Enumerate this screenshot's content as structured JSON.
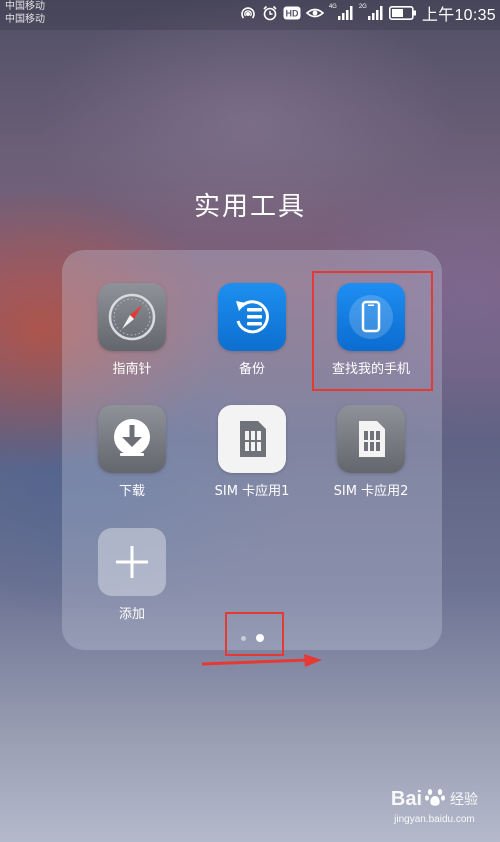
{
  "status_bar": {
    "carrier_1": "中国移动",
    "carrier_2": "中国移动",
    "hd_badge": "HD",
    "network_1": "4G",
    "network_2": "2G",
    "time": "上午10:35",
    "icons": [
      "hotspot-icon",
      "alarm-icon",
      "hd-call-icon",
      "eye-comfort-icon",
      "signal-icon",
      "battery-icon"
    ]
  },
  "folder": {
    "title": "实用工具",
    "apps": [
      {
        "label": "指南针",
        "icon": "compass-icon"
      },
      {
        "label": "备份",
        "icon": "backup-icon"
      },
      {
        "label": "查找我的手机",
        "icon": "find-my-phone-icon"
      },
      {
        "label": "下载",
        "icon": "download-icon"
      },
      {
        "label": "SIM 卡应用1",
        "icon": "sim-card-icon"
      },
      {
        "label": "SIM 卡应用2",
        "icon": "sim-card-icon"
      },
      {
        "label": "添加",
        "icon": "plus-icon"
      }
    ],
    "pages": {
      "total": 2,
      "current": 2
    }
  },
  "annotation_color": "#e53935",
  "watermark": {
    "logo_text": "Bai",
    "logo_text_2": "du",
    "logo_cn": "经验",
    "url": "jingyan.baidu.com"
  }
}
